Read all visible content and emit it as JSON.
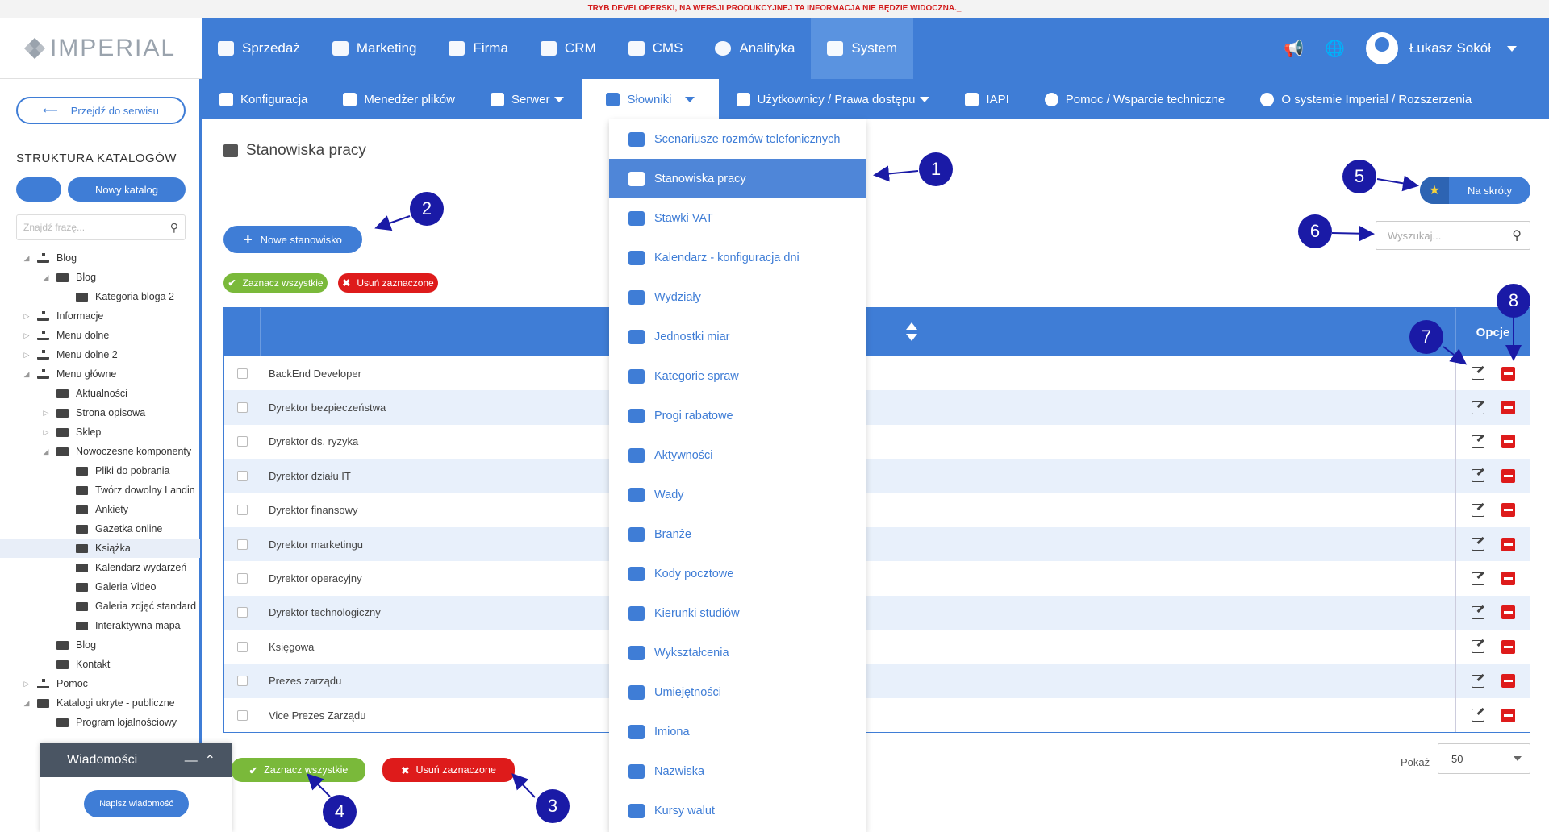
{
  "dev_banner": "TRYB DEVELOPERSKI, NA WERSJI PRODUKCYJNEJ TA INFORMACJA NIE BĘDZIE WIDOCZNA._",
  "logo": "IMPERIAL",
  "top_nav": [
    {
      "label": "Sprzedaż",
      "icon": "box-icon"
    },
    {
      "label": "Marketing",
      "icon": "megaphone-icon"
    },
    {
      "label": "Firma",
      "icon": "building-icon"
    },
    {
      "label": "CRM",
      "icon": "document-icon"
    },
    {
      "label": "CMS",
      "icon": "window-icon"
    },
    {
      "label": "Analityka",
      "icon": "pie-chart-icon"
    },
    {
      "label": "System",
      "icon": "system-icon"
    }
  ],
  "user": {
    "name": "Łukasz Sokół"
  },
  "sub_nav": [
    {
      "label": "Konfiguracja"
    },
    {
      "label": "Menedżer plików"
    },
    {
      "label": "Serwer"
    },
    {
      "label": "Słowniki"
    },
    {
      "label": "Użytkownicy / Prawa dostępu"
    },
    {
      "label": "IAPI"
    },
    {
      "label": "Pomoc / Wsparcie techniczne"
    },
    {
      "label": "O systemie Imperial / Rozszerzenia"
    }
  ],
  "sidebar": {
    "go_to_service": "Przejdź do serwisu",
    "title": "STRUKTURA KATALOGÓW",
    "new_catalog": "Nowy katalog",
    "search_placeholder": "Znajdź frazę...",
    "tree": [
      {
        "label": "Blog",
        "level": 0,
        "toggle": "◢",
        "type": "tree"
      },
      {
        "label": "Blog",
        "level": 1,
        "toggle": "◢",
        "type": "folder"
      },
      {
        "label": "Kategoria bloga 2",
        "level": 2,
        "toggle": "",
        "type": "folder"
      },
      {
        "label": "Informacje",
        "level": 0,
        "toggle": "▷",
        "type": "tree"
      },
      {
        "label": "Menu dolne",
        "level": 0,
        "toggle": "▷",
        "type": "tree"
      },
      {
        "label": "Menu dolne 2",
        "level": 0,
        "toggle": "▷",
        "type": "tree"
      },
      {
        "label": "Menu główne",
        "level": 0,
        "toggle": "◢",
        "type": "tree"
      },
      {
        "label": "Aktualności",
        "level": 1,
        "toggle": "",
        "type": "folder"
      },
      {
        "label": "Strona opisowa",
        "level": 1,
        "toggle": "▷",
        "type": "folder"
      },
      {
        "label": "Sklep",
        "level": 1,
        "toggle": "▷",
        "type": "folder"
      },
      {
        "label": "Nowoczesne komponenty",
        "level": 1,
        "toggle": "◢",
        "type": "folder"
      },
      {
        "label": "Pliki do pobrania",
        "level": 2,
        "toggle": "",
        "type": "folder"
      },
      {
        "label": "Twórz dowolny Landin",
        "level": 2,
        "toggle": "",
        "type": "folder"
      },
      {
        "label": "Ankiety",
        "level": 2,
        "toggle": "",
        "type": "folder"
      },
      {
        "label": "Gazetka online",
        "level": 2,
        "toggle": "",
        "type": "folder"
      },
      {
        "label": "Książka",
        "level": 2,
        "toggle": "",
        "type": "folder",
        "selected": true
      },
      {
        "label": "Kalendarz wydarzeń",
        "level": 2,
        "toggle": "",
        "type": "folder"
      },
      {
        "label": "Galeria Video",
        "level": 2,
        "toggle": "",
        "type": "folder"
      },
      {
        "label": "Galeria zdjęć standard",
        "level": 2,
        "toggle": "",
        "type": "folder"
      },
      {
        "label": "Interaktywna mapa",
        "level": 2,
        "toggle": "",
        "type": "folder"
      },
      {
        "label": "Blog",
        "level": 1,
        "toggle": "",
        "type": "folder"
      },
      {
        "label": "Kontakt",
        "level": 1,
        "toggle": "",
        "type": "folder"
      },
      {
        "label": "Pomoc",
        "level": 0,
        "toggle": "▷",
        "type": "tree"
      },
      {
        "label": "Katalogi ukryte - publiczne",
        "level": 0,
        "toggle": "◢",
        "type": "folder"
      },
      {
        "label": "Program lojalnościowy",
        "level": 1,
        "toggle": "",
        "type": "folder"
      }
    ]
  },
  "messages": {
    "title": "Wiadomości",
    "write": "Napisz wiadomość"
  },
  "page": {
    "title": "Stanowiska pracy",
    "new_button": "Nowe stanowisko",
    "select_all": "Zaznacz wszystkie",
    "delete_selected": "Usuń zaznaczone",
    "shortcuts": "Na skróty",
    "search_placeholder": "Wyszukaj...",
    "options_header": "Opcje",
    "show_label": "Pokaż",
    "per_page": "50"
  },
  "rows": [
    "BackEnd Developer",
    "Dyrektor bezpieczeństwa",
    "Dyrektor ds. ryzyka",
    "Dyrektor działu IT",
    "Dyrektor finansowy",
    "Dyrektor marketingu",
    "Dyrektor operacyjny",
    "Dyrektor technologiczny",
    "Księgowa",
    "Prezes zarządu",
    "Vice Prezes Zarządu"
  ],
  "dropdown": [
    "Scenariusze rozmów telefonicznych",
    "Stanowiska pracy",
    "Stawki VAT",
    "Kalendarz - konfiguracja dni",
    "Wydziały",
    "Jednostki miar",
    "Kategorie spraw",
    "Progi rabatowe",
    "Aktywności",
    "Wady",
    "Branże",
    "Kody pocztowe",
    "Kierunki studiów",
    "Wykształcenia",
    "Umiejętności",
    "Imiona",
    "Nazwiska",
    "Kursy walut"
  ],
  "callouts": [
    "1",
    "2",
    "3",
    "4",
    "5",
    "6",
    "7",
    "8"
  ],
  "colors": {
    "primary": "#3f7dd6",
    "green": "#7ab93a",
    "red": "#de1b1b",
    "callout": "#1a1aa6"
  }
}
